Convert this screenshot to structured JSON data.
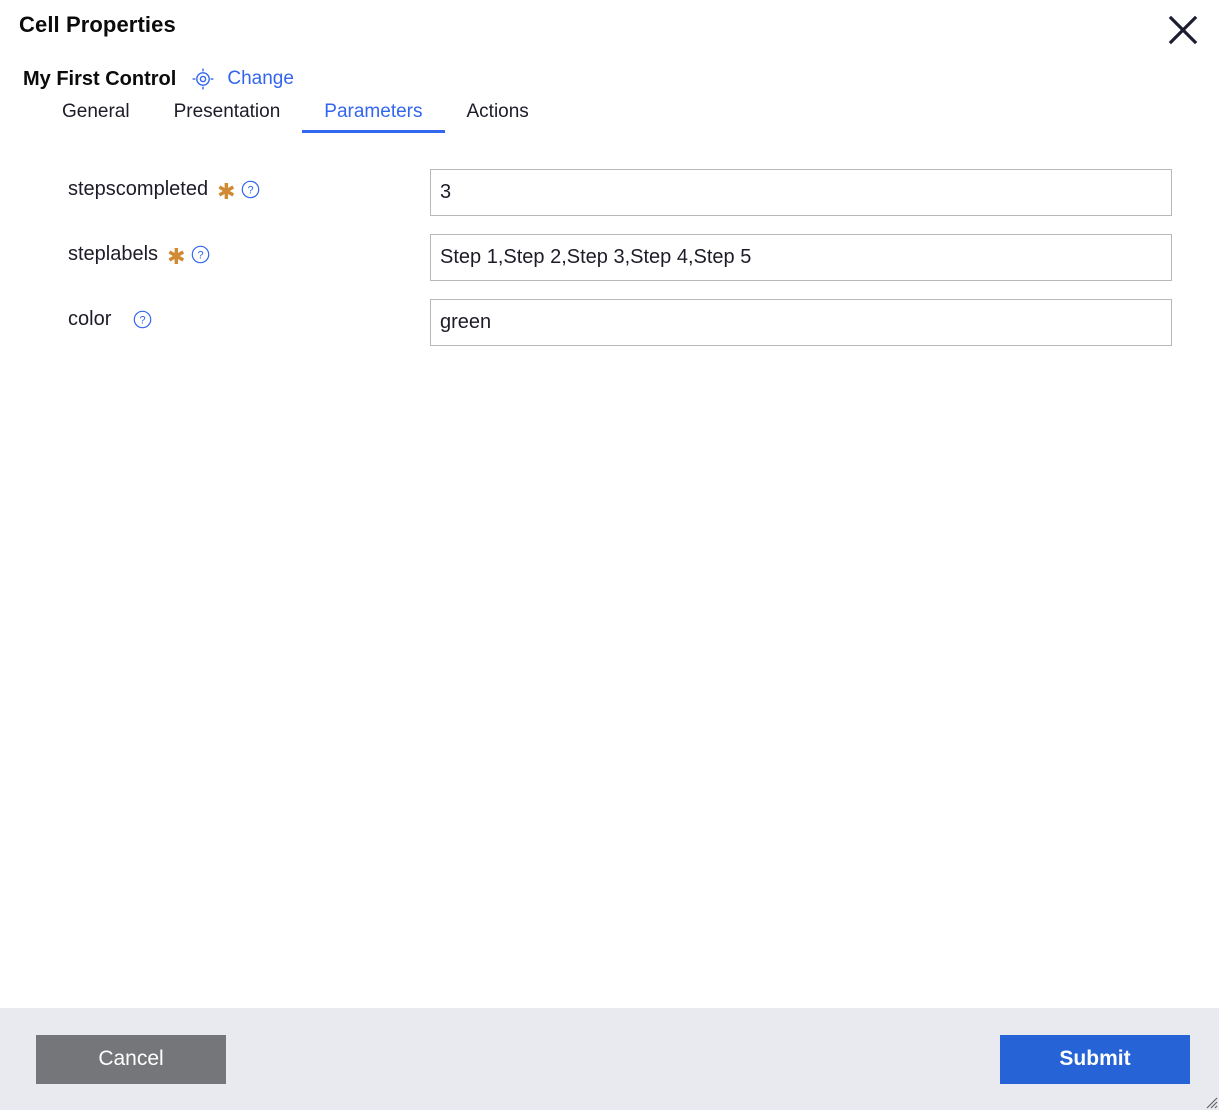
{
  "dialog": {
    "title": "Cell Properties",
    "close_icon": "close-icon"
  },
  "control": {
    "name": "My First Control",
    "target_icon": "target-icon",
    "change_label": "Change"
  },
  "tabs": [
    {
      "label": "General",
      "active": false
    },
    {
      "label": "Presentation",
      "active": false
    },
    {
      "label": "Parameters",
      "active": true
    },
    {
      "label": "Actions",
      "active": false
    }
  ],
  "parameters": [
    {
      "label": "stepscompleted",
      "required": true,
      "required_marker": "✱",
      "help_icon": "help-icon",
      "value": "3",
      "placeholder": ""
    },
    {
      "label": "steplabels",
      "required": true,
      "required_marker": "✱",
      "help_icon": "help-icon",
      "value": "Step 1,Step 2,Step 3,Step 4,Step 5",
      "placeholder": ""
    },
    {
      "label": "color",
      "required": false,
      "required_marker": "",
      "help_icon": "help-icon",
      "value": "green",
      "placeholder": ""
    }
  ],
  "footer": {
    "cancel_label": "Cancel",
    "submit_label": "Submit",
    "resize_grip_icon": "resize-grip-icon"
  },
  "colors": {
    "accent_blue": "#3366ee",
    "submit_blue": "#2563d6",
    "cancel_gray": "#757679",
    "required_orange": "#cf8a33",
    "footer_bg": "#e8eaef",
    "input_border": "#b8b8b8",
    "text_dark": "#1c1c28"
  }
}
